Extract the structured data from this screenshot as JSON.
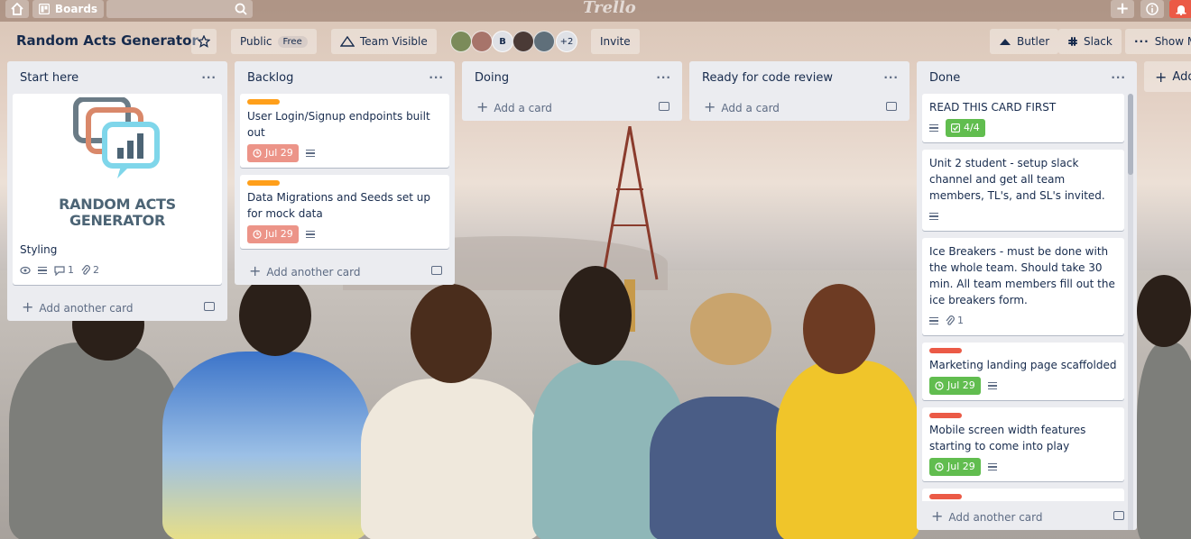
{
  "topbar": {
    "boards_label": "Boards",
    "logo_text": "Trello"
  },
  "board": {
    "name": "Random Acts Generator",
    "visibility_label": "Public",
    "visibility_badge": "Free",
    "team_label": "Team Visible",
    "extra_members": "+2",
    "member_initial": "B",
    "invite_label": "Invite",
    "butler_label": "Butler",
    "slack_label": "Slack",
    "show_menu_label": "Show M"
  },
  "lists": [
    {
      "title": "Start here",
      "add_label": "Add another card",
      "cards": [
        {
          "title": "Styling",
          "cover_text": "RANDOM ACTS GENERATOR",
          "comments": "1",
          "attachments": "2"
        }
      ]
    },
    {
      "title": "Backlog",
      "add_label": "Add another card",
      "cards": [
        {
          "title": "User Login/Signup endpoints built out",
          "due": "Jul 29"
        },
        {
          "title": "Data Migrations and Seeds set up for mock data",
          "due": "Jul 29"
        }
      ]
    },
    {
      "title": "Doing",
      "add_label": "Add a card",
      "cards": []
    },
    {
      "title": "Ready for code review",
      "add_label": "Add a card",
      "cards": []
    },
    {
      "title": "Done",
      "add_label": "Add another card",
      "cards": [
        {
          "title": "READ THIS CARD FIRST",
          "checklist": "4/4"
        },
        {
          "title": "Unit 2 student - setup slack channel and get all team members, TL's, and SL's invited."
        },
        {
          "title": "Ice Breakers - must be done with the whole team. Should take 30 min. All team members fill out the ice breakers form.",
          "attachments": "1"
        },
        {
          "title": "Marketing landing page scaffolded",
          "due": "Jul 29"
        },
        {
          "title": "Mobile screen width features starting to come into play",
          "due": "Jul 29"
        }
      ]
    }
  ],
  "add_list_label": "Add",
  "colors": {
    "label_orange": "#ff9f1a",
    "label_red": "#eb5a46",
    "due_overdue": "#ec9488",
    "due_complete": "#61bd4f"
  }
}
